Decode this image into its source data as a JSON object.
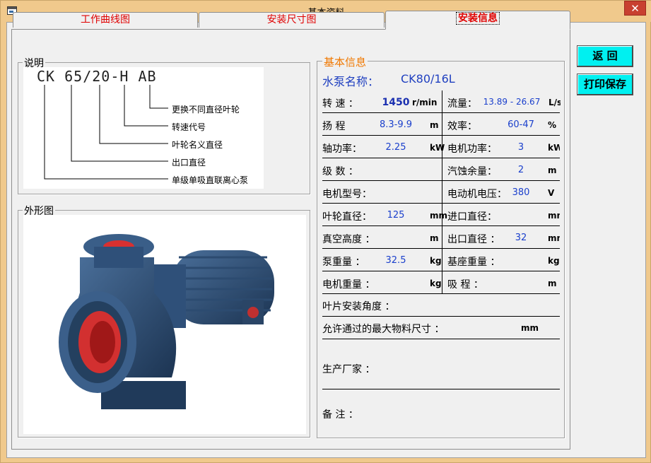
{
  "window": {
    "title": "基本资料",
    "close_glyph": "✕"
  },
  "tabs": [
    {
      "label": "工作曲线图"
    },
    {
      "label": "安装尺寸图"
    },
    {
      "label": "安装信息"
    }
  ],
  "explanation": {
    "legend": "说明",
    "code": "CK 65/20-H AB",
    "items": [
      "更换不同直径叶轮",
      "转速代号",
      "叶轮名义直径",
      "出口直径",
      "单级单吸直联离心泵"
    ]
  },
  "appearance": {
    "legend": "外形图",
    "image": "pump-photo"
  },
  "info": {
    "legend": "基本信息",
    "pump_name_label": "水泵名称：",
    "pump_name": "CK80/16L",
    "rows": [
      {
        "l_label": "转 速 ：",
        "l_value": "1450",
        "l_unit": "r/min",
        "r_label": "流量：",
        "r_value": "13.89 - 26.67",
        "r_unit": "L/s"
      },
      {
        "l_label": "扬 程",
        "l_value": "8.3-9.9",
        "l_unit": "m",
        "r_label": "效率：",
        "r_value": "60-47",
        "r_unit": "%"
      },
      {
        "l_label": "轴功率：",
        "l_value": "2.25",
        "l_unit": "kW",
        "r_label": "电机功率：",
        "r_value": "3",
        "r_unit": "kW"
      },
      {
        "l_label": "级 数 ：",
        "l_value": "",
        "l_unit": "",
        "r_label": "汽蚀余量：",
        "r_value": "2",
        "r_unit": "m"
      },
      {
        "l_label": "电机型号：",
        "l_value": "",
        "l_unit": "",
        "r_label": "电动机电压：",
        "r_value": "380",
        "r_unit": "V"
      },
      {
        "l_label": "叶轮直径：",
        "l_value": "125",
        "l_unit": "mm",
        "r_label": "进口直径：",
        "r_value": "",
        "r_unit": "mm"
      },
      {
        "l_label": "真空高度 ：",
        "l_value": "",
        "l_unit": "m",
        "r_label": "出口直径 ：",
        "r_value": "32",
        "r_unit": "mm"
      },
      {
        "l_label": "泵重量 ：",
        "l_value": "32.5",
        "l_unit": "kg",
        "r_label": "基座重量 ：",
        "r_value": "",
        "r_unit": "kg"
      },
      {
        "l_label": "电机重量 ：",
        "l_value": "",
        "l_unit": "kg",
        "r_label": "吸 程 ：",
        "r_value": "",
        "r_unit": "m"
      }
    ],
    "blade_angle_label": "叶片安装角度 ：",
    "max_material_label": "允许通过的最大物料尺寸 ：",
    "max_material_unit": "mm",
    "manufacturer_label": "生产厂家 ：",
    "remarks_label": "备 注 ："
  },
  "buttons": {
    "back": "返 回",
    "print_save": "打印保存"
  },
  "colors": {
    "tab_text": "#e00000",
    "value_text": "#1a3fcc",
    "info_legend": "#f07800",
    "button_bg": "#00f0f0"
  }
}
